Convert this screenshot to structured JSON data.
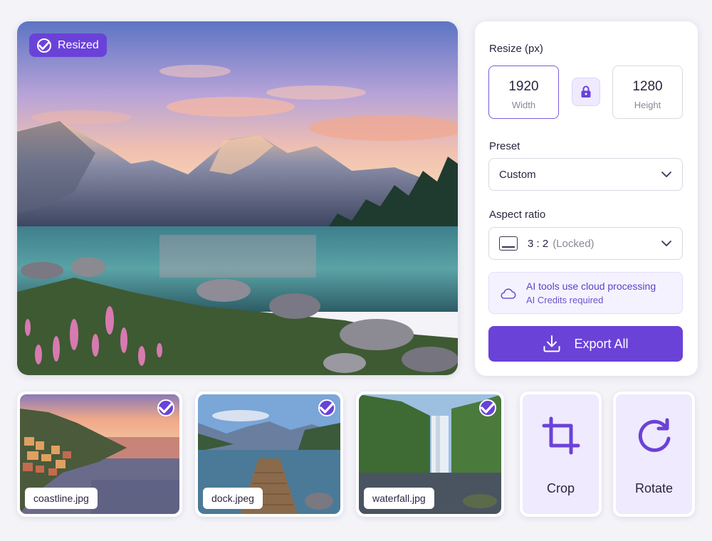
{
  "preview": {
    "badge_label": "Resized"
  },
  "panel": {
    "resize_label": "Resize (px)",
    "width_value": "1920",
    "width_caption": "Width",
    "height_value": "1280",
    "height_caption": "Height",
    "preset_label": "Preset",
    "preset_value": "Custom",
    "aspect_label": "Aspect ratio",
    "aspect_value": "3 : 2",
    "aspect_note": "(Locked)",
    "info_line1": "AI tools use cloud processing",
    "info_line2": "AI Credits required",
    "export_label": "Export All"
  },
  "thumbnails": [
    {
      "filename": "coastline.jpg",
      "selected": true
    },
    {
      "filename": "dock.jpeg",
      "selected": true
    },
    {
      "filename": "waterfall.jpg",
      "selected": true
    }
  ],
  "tools": {
    "crop_label": "Crop",
    "rotate_label": "Rotate"
  },
  "colors": {
    "accent": "#6a42d8",
    "accent_light": "#efeafe",
    "background": "#f3f3f8"
  }
}
